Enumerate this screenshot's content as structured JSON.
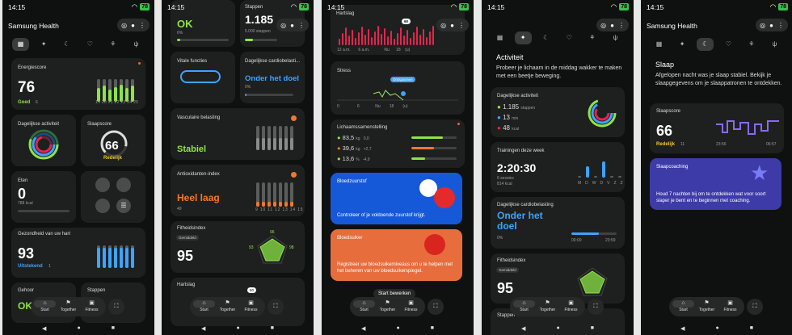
{
  "status": {
    "time": "14:15",
    "battery": "78"
  },
  "app_title": "Samsung Health",
  "nav": {
    "start": "Start",
    "together": "Together",
    "fitness": "Fitness",
    "edit": "Start bewerken"
  },
  "s1": {
    "energy": {
      "label": "Energiescore",
      "value": "76",
      "rating": "Goed",
      "count": "6",
      "days": [
        "19",
        "20",
        "21",
        "22",
        "23",
        "24",
        "25"
      ],
      "levels": [
        0.6,
        0.7,
        0.55,
        0.65,
        0.75,
        0.6,
        0.7
      ]
    },
    "activity": {
      "label": "Dagelijkse activiteit"
    },
    "sleep": {
      "label": "Slaapscore",
      "value": "66",
      "rating": "Redelijk"
    },
    "food": {
      "label": "Eten",
      "value": "0",
      "unit": "788 kcal"
    },
    "heart": {
      "label": "Gezondheid van uw hart",
      "value": "93",
      "rating": "Uitstekend",
      "count": "1",
      "days": [
        "19",
        "20",
        "21",
        "22",
        "23",
        "24",
        "25"
      ]
    },
    "hearing": {
      "label": "Gehoor",
      "value": "OK"
    },
    "steps": {
      "label": "Stappen",
      "value": "app"
    }
  },
  "s2": {
    "hearing": {
      "value": "OK",
      "pct": "6%"
    },
    "steps": {
      "label": "Stappen",
      "value": "1.185",
      "sub": "5.000 stappen"
    },
    "vital": {
      "label": "Vitale functies"
    },
    "cardio": {
      "label": "Dagelijkse cardiobelasti...",
      "value": "Onder het doel",
      "pct": "0%"
    },
    "vascular": {
      "label": "Vasculaire belasting",
      "value": "Stabiel"
    },
    "antiox": {
      "label": "Antioxidanten-index",
      "value": "Heel laag",
      "sub": "49",
      "days": [
        "9",
        "10",
        "11",
        "12",
        "13",
        "14",
        "15"
      ]
    },
    "fitness": {
      "label": "Fitheidsindex",
      "pill": "Gemiddeld",
      "value": "95",
      "radar": [
        "96",
        "98",
        "98",
        "93",
        "93"
      ]
    },
    "hr": {
      "label": "Hartslag",
      "badge": "60",
      "ticks": [
        "12 a.m.",
        "6 a.m."
      ]
    },
    "days": [
      "19",
      "20",
      "21",
      "22",
      "23",
      "24",
      "25"
    ]
  },
  "s3": {
    "hr": {
      "label": "Hartslag",
      "badge": "60",
      "ticks": [
        "12 a.m.",
        "6 a.m.",
        "Nu",
        "18",
        "(u)"
      ]
    },
    "stress": {
      "label": "Stress",
      "state": "Ontspannen",
      "ticks": [
        "0",
        "6",
        "Nu",
        "18",
        "(u)"
      ]
    },
    "body": {
      "label": "Lichaamssamenstelling",
      "rows": [
        {
          "v": "83,5",
          "u": "kg",
          "d": "0,0"
        },
        {
          "v": "39,6",
          "u": "kg",
          "d": "+2,7"
        },
        {
          "v": "13,6",
          "u": "%",
          "d": "-4,9"
        }
      ]
    },
    "oxygen": {
      "label": "Bloedzuurstof",
      "text": "Controleer of je voldoende zuurstof krijgt."
    },
    "sugar": {
      "label": "Bloedsuiker",
      "text": "Registreer uw bloedsuikerniveaus om u te helpen met het beheren van uw bloedsuikerspiegel."
    }
  },
  "s4": {
    "title": "Activiteit",
    "desc": "Probeer je lichaam in de middag wakker te maken met een beetje beweging.",
    "daily": {
      "label": "Dagelijkse activiteit",
      "steps": "1.185",
      "steps_u": "stappen",
      "min": "13",
      "min_u": "min",
      "kcal": "48",
      "kcal_u": "kcal"
    },
    "train": {
      "label": "Trainingen deze week",
      "value": "2:20:30",
      "sessions": "6 sessies",
      "kcal": "814 kcal",
      "days": [
        "M",
        "D",
        "W",
        "D",
        "V",
        "Z",
        "Z"
      ]
    },
    "cardio": {
      "label": "Dagelijkse cardiobelasting",
      "value": "Onder het doel",
      "pct": "0%",
      "t0": "00:00",
      "t1": "23:59"
    },
    "fitness": {
      "label": "Fitheidsindex",
      "pill": "Gemiddeld",
      "value": "95",
      "radar": [
        "96",
        "98",
        "98",
        "93",
        "93"
      ]
    },
    "steps": {
      "label": "Stappen"
    }
  },
  "s5": {
    "title": "Slaap",
    "desc": "Afgelopen nacht was je slaap stabiel. Bekijk je slaapgegevens om je slaappatronen te ontdekken.",
    "score": {
      "label": "Slaapscore",
      "value": "66",
      "rating": "Redelijk",
      "count": "11",
      "t0": "23:56",
      "t1": "06:57"
    },
    "coach": {
      "label": "Slaapcoaching",
      "text": "Houd 7 nachten bij om te ontdekken wat voor soort slaper je bent en te beginnen met coaching."
    }
  },
  "colors": {
    "green": "#8fe34a",
    "blue": "#3ea3ff",
    "orange": "#f3782a",
    "red": "#e2264d"
  }
}
